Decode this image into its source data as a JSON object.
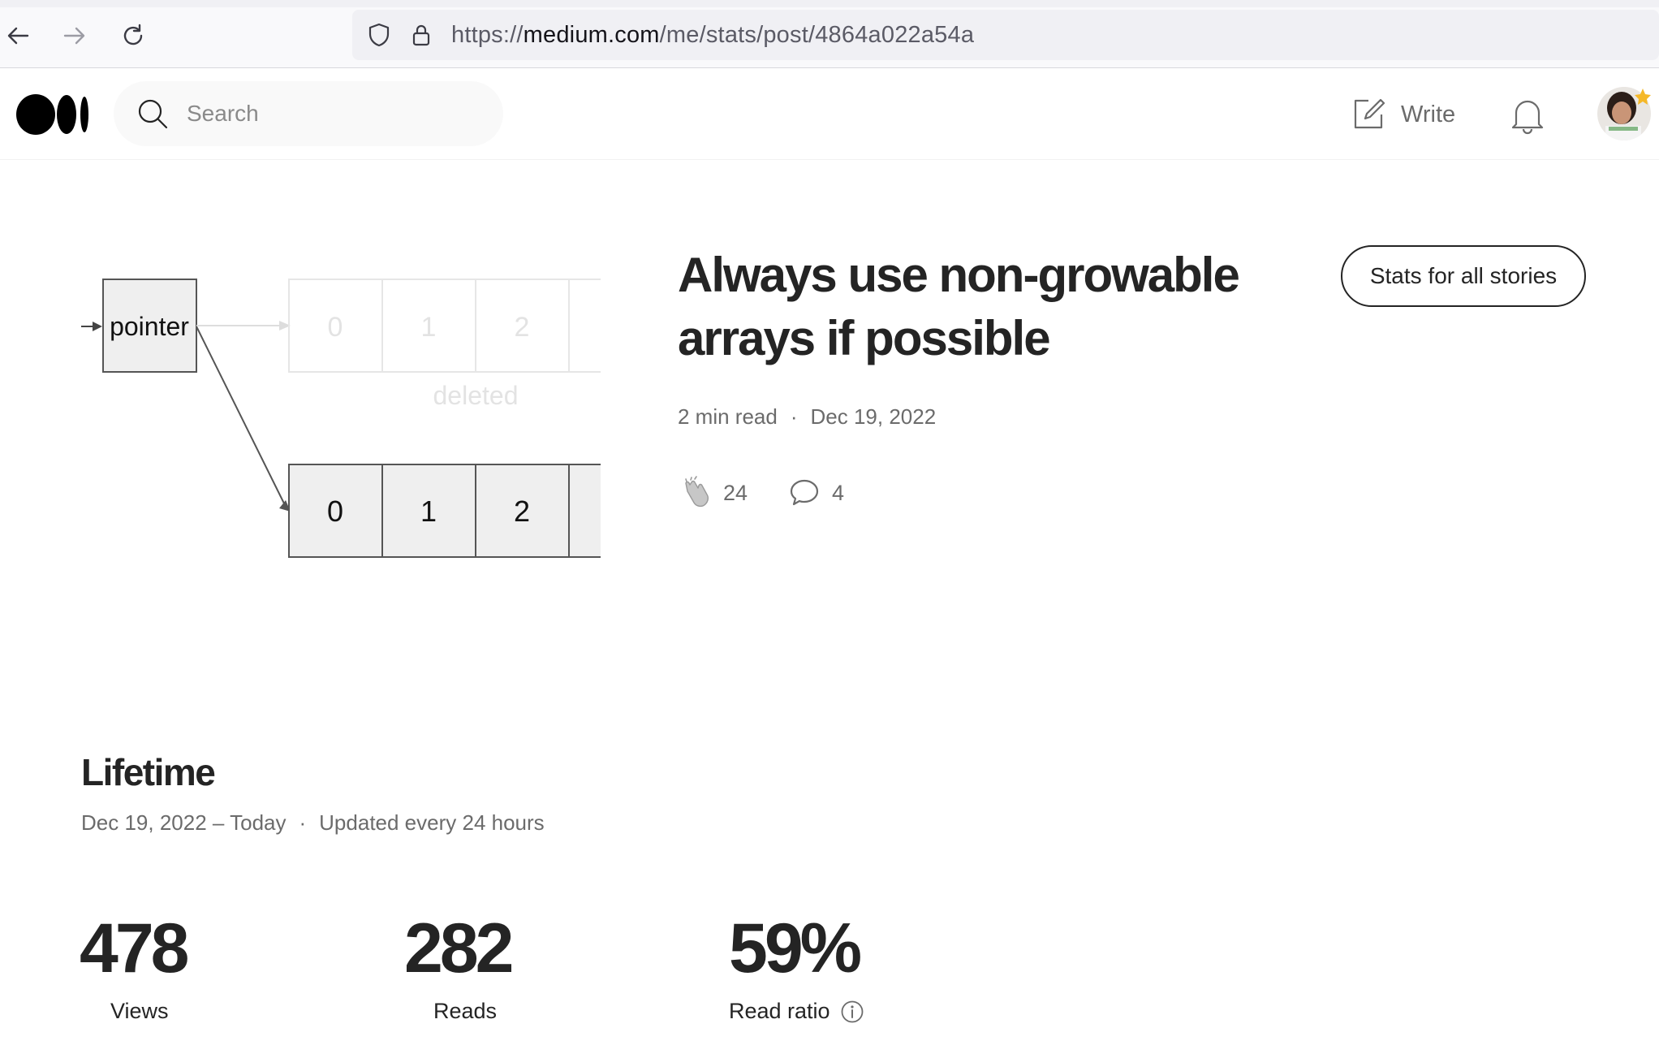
{
  "browser": {
    "url_prefix": "https://",
    "url_host": "medium.com",
    "url_path": "/me/stats/post/4864a022a54a",
    "icons": [
      "back-arrow-icon",
      "forward-arrow-icon",
      "reload-icon",
      "shield-icon",
      "lock-icon"
    ]
  },
  "header": {
    "search_placeholder": "Search",
    "write_label": "Write",
    "icons": [
      "medium-logo",
      "search-icon",
      "write-icon",
      "bell-icon"
    ]
  },
  "story": {
    "title": "Always use non-growable arrays if possible",
    "read_time": "2 min read",
    "dot": "·",
    "date": "Dec 19, 2022",
    "claps": "24",
    "responses": "4",
    "stats_button_label": "Stats for all stories",
    "thumbnail": {
      "pointer_label": "pointer",
      "old_cells": [
        "0",
        "1",
        "2"
      ],
      "deleted_label": "deleted",
      "new_cells": [
        "0",
        "1",
        "2"
      ]
    }
  },
  "lifetime": {
    "title": "Lifetime",
    "range": "Dec 19, 2022 – Today",
    "dot": "·",
    "updated": "Updated every 24 hours",
    "stats": [
      {
        "value": "478",
        "label": "Views"
      },
      {
        "value": "282",
        "label": "Reads"
      },
      {
        "value": "59%",
        "label": "Read ratio"
      }
    ]
  },
  "colors": {
    "text": "#242424",
    "muted": "#6b6b6b",
    "accent_star": "#f5b828"
  }
}
